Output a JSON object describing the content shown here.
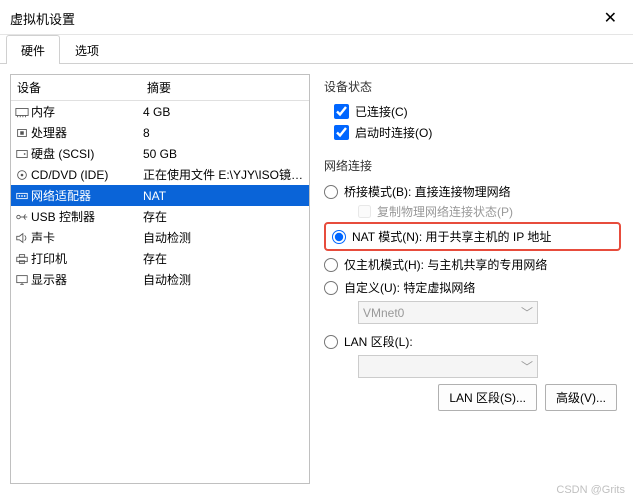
{
  "window": {
    "title": "虚拟机设置"
  },
  "tabs": {
    "hardware": "硬件",
    "options": "选项"
  },
  "list": {
    "header_device": "设备",
    "header_summary": "摘要",
    "rows": [
      {
        "icon": "memory",
        "label": "内存",
        "summary": "4 GB"
      },
      {
        "icon": "cpu",
        "label": "处理器",
        "summary": "8"
      },
      {
        "icon": "disk",
        "label": "硬盘 (SCSI)",
        "summary": "50 GB"
      },
      {
        "icon": "cd",
        "label": "CD/DVD (IDE)",
        "summary": "正在使用文件 E:\\YJY\\ISO镜像\\..."
      },
      {
        "icon": "net",
        "label": "网络适配器",
        "summary": "NAT",
        "selected": true
      },
      {
        "icon": "usb",
        "label": "USB 控制器",
        "summary": "存在"
      },
      {
        "icon": "sound",
        "label": "声卡",
        "summary": "自动检测"
      },
      {
        "icon": "printer",
        "label": "打印机",
        "summary": "存在"
      },
      {
        "icon": "display",
        "label": "显示器",
        "summary": "自动检测"
      }
    ]
  },
  "status": {
    "title": "设备状态",
    "connected": "已连接(C)",
    "connect_on_poweron": "启动时连接(O)"
  },
  "network": {
    "title": "网络连接",
    "bridged": "桥接模式(B): 直接连接物理网络",
    "replicate": "复制物理网络连接状态(P)",
    "nat": "NAT 模式(N): 用于共享主机的 IP 地址",
    "hostonly": "仅主机模式(H): 与主机共享的专用网络",
    "custom": "自定义(U): 特定虚拟网络",
    "vmnet": "VMnet0",
    "lansegment": "LAN 区段(L):"
  },
  "buttons": {
    "lansegments": "LAN 区段(S)...",
    "advanced": "高级(V)..."
  },
  "watermark": "CSDN @Grits"
}
